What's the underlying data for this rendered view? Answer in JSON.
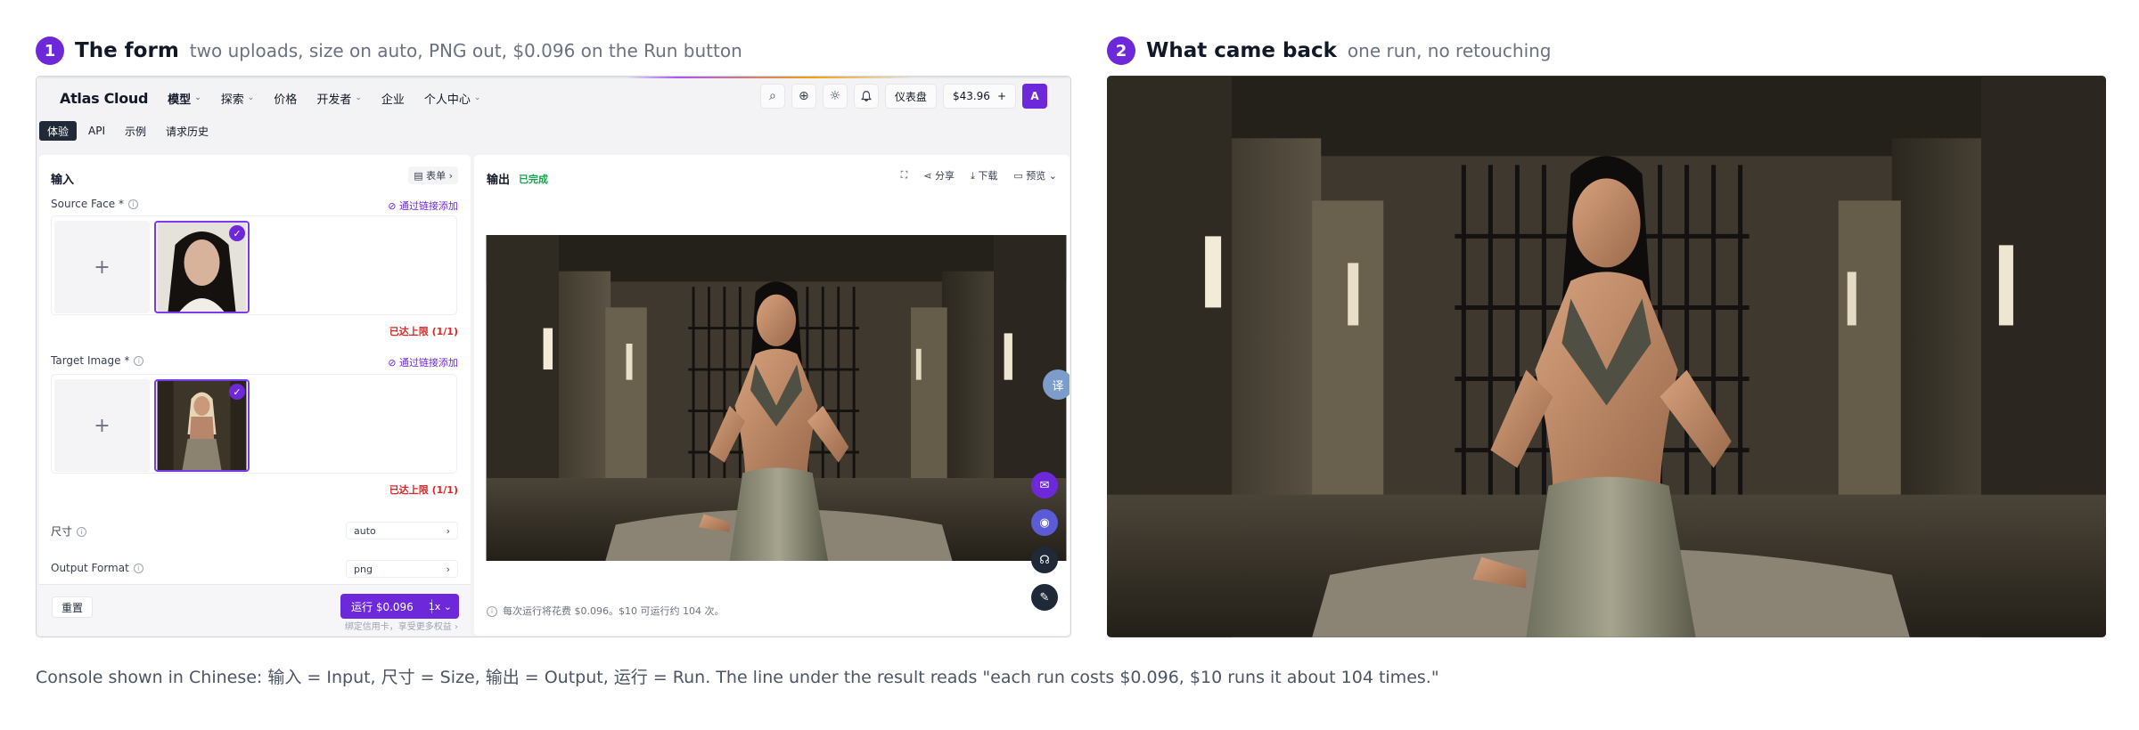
{
  "section1": {
    "step": "1",
    "title": "The form",
    "subtitle": "two uploads, size on auto, PNG out, $0.096 on the Run button"
  },
  "section2": {
    "step": "2",
    "title": "What came back",
    "subtitle": "one run, no retouching"
  },
  "caption": "Console shown in Chinese: 输入 = Input, 尺寸 = Size, 输出 = Output, 运行 = Run. The line under the result reads \"each run costs $0.096, $10 runs it about 104 times.\"",
  "console": {
    "logo": "Atlas Cloud",
    "nav": [
      {
        "label": "模型",
        "caret": "⌄",
        "active": true
      },
      {
        "label": "探索",
        "caret": "⌄"
      },
      {
        "label": "价格",
        "caret": ""
      },
      {
        "label": "开发者",
        "caret": "⌄"
      },
      {
        "label": "企业",
        "caret": ""
      },
      {
        "label": "个人中心",
        "caret": "⌄"
      }
    ],
    "nav_icons": {
      "search": "⌕",
      "globe": "⊕",
      "theme": "☼",
      "bell": "♫"
    },
    "dashboard_label": "仪表盘",
    "balance": "$43.96",
    "balance_add": "+",
    "avatar": "A",
    "subtabs": [
      "体验",
      "API",
      "示例",
      "请求历史"
    ],
    "input": {
      "title": "输入",
      "form_btn": "▤ 表单 ›",
      "source_face": {
        "label": "Source Face *",
        "link": "⊘ 通过链接添加",
        "plus": "+",
        "limit": "已达上限 (1/1)"
      },
      "target_image": {
        "label": "Target Image *",
        "link": "⊘ 通过链接添加",
        "plus": "+",
        "limit": "已达上限 (1/1)"
      },
      "size": {
        "label": "尺寸",
        "value": "auto"
      },
      "output_format": {
        "label": "Output Format",
        "value": "png"
      },
      "reset": "重置",
      "run": "运行 $0.096",
      "multiplier": "1x ⌄",
      "bind_text": "绑定信用卡，享受更多权益 ›"
    },
    "output": {
      "title": "输出",
      "status": "已完成",
      "tools": [
        "⛶",
        "⋖ 分享",
        "⤓ 下载",
        "▭ 预览 ⌄"
      ],
      "note": "每次运行将花费 $0.096。$10 可运行约 104 次。"
    }
  },
  "colors": {
    "accent": "#6d28d9",
    "success": "#16a34a",
    "warning": "#dc2626"
  }
}
